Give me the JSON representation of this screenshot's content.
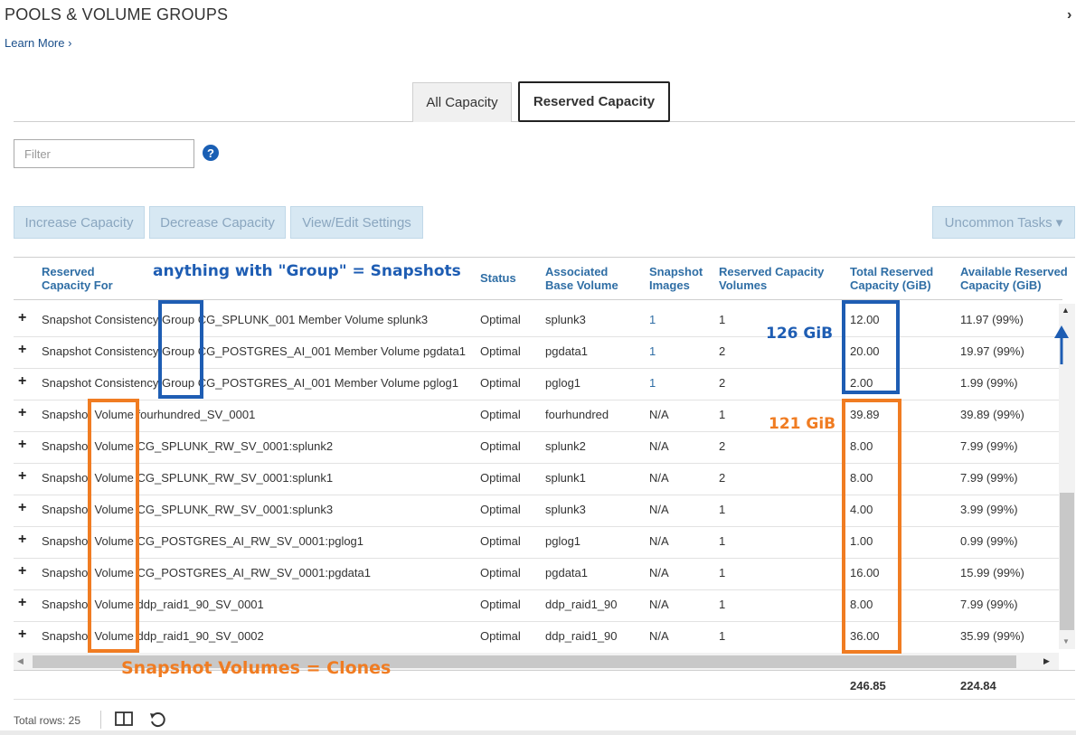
{
  "header": {
    "title": "POOLS & VOLUME GROUPS",
    "learn_more": "Learn More ›"
  },
  "tabs": [
    {
      "label": "All Capacity",
      "active": false
    },
    {
      "label": "Reserved Capacity",
      "active": true
    }
  ],
  "filter": {
    "placeholder": "Filter"
  },
  "toolbar": {
    "increase": "Increase Capacity",
    "decrease": "Decrease Capacity",
    "view_edit": "View/Edit Settings",
    "uncommon": "Uncommon Tasks ▾"
  },
  "columns": {
    "reserved_for": "Reserved Capacity For",
    "status": "Status",
    "base_volume": "Associated Base Volume",
    "snapshot_images": "Snapshot Images",
    "rc_volumes": "Reserved Capacity Volumes",
    "total_reserved": "Total Reserved Capacity (GiB)",
    "available_reserved": "Available Reserved Capacity (GiB)"
  },
  "rows": [
    {
      "name": "Snapshot Consistency Group CG_SPLUNK_001 Member Volume splunk3",
      "status": "Optimal",
      "base": "splunk3",
      "images": "1",
      "volumes": "1",
      "total": "12.00",
      "available": "11.97 (99%)"
    },
    {
      "name": "Snapshot Consistency Group CG_POSTGRES_AI_001 Member Volume pgdata1",
      "status": "Optimal",
      "base": "pgdata1",
      "images": "1",
      "volumes": "2",
      "total": "20.00",
      "available": "19.97 (99%)"
    },
    {
      "name": "Snapshot Consistency Group CG_POSTGRES_AI_001 Member Volume pglog1",
      "status": "Optimal",
      "base": "pglog1",
      "images": "1",
      "volumes": "2",
      "total": "2.00",
      "available": "1.99 (99%)"
    },
    {
      "name": "Snapshot Volume fourhundred_SV_0001",
      "status": "Optimal",
      "base": "fourhundred",
      "images": "N/A",
      "volumes": "1",
      "total": "39.89",
      "available": "39.89 (99%)"
    },
    {
      "name": "Snapshot Volume CG_SPLUNK_RW_SV_0001:splunk2",
      "status": "Optimal",
      "base": "splunk2",
      "images": "N/A",
      "volumes": "2",
      "total": "8.00",
      "available": "7.99 (99%)"
    },
    {
      "name": "Snapshot Volume CG_SPLUNK_RW_SV_0001:splunk1",
      "status": "Optimal",
      "base": "splunk1",
      "images": "N/A",
      "volumes": "2",
      "total": "8.00",
      "available": "7.99 (99%)"
    },
    {
      "name": "Snapshot Volume CG_SPLUNK_RW_SV_0001:splunk3",
      "status": "Optimal",
      "base": "splunk3",
      "images": "N/A",
      "volumes": "1",
      "total": "4.00",
      "available": "3.99 (99%)"
    },
    {
      "name": "Snapshot Volume CG_POSTGRES_AI_RW_SV_0001:pglog1",
      "status": "Optimal",
      "base": "pglog1",
      "images": "N/A",
      "volumes": "1",
      "total": "1.00",
      "available": "0.99 (99%)"
    },
    {
      "name": "Snapshot Volume CG_POSTGRES_AI_RW_SV_0001:pgdata1",
      "status": "Optimal",
      "base": "pgdata1",
      "images": "N/A",
      "volumes": "1",
      "total": "16.00",
      "available": "15.99 (99%)"
    },
    {
      "name": "Snapshot Volume ddp_raid1_90_SV_0001",
      "status": "Optimal",
      "base": "ddp_raid1_90",
      "images": "N/A",
      "volumes": "1",
      "total": "8.00",
      "available": "7.99 (99%)"
    },
    {
      "name": "Snapshot Volume ddp_raid1_90_SV_0002",
      "status": "Optimal",
      "base": "ddp_raid1_90",
      "images": "N/A",
      "volumes": "1",
      "total": "36.00",
      "available": "35.99 (99%)"
    }
  ],
  "totals": {
    "total_reserved": "246.85",
    "available_reserved": "224.84"
  },
  "footer": {
    "total_rows": "Total rows: 25"
  },
  "annotations": {
    "group_note": "anything with \"Group\" = Snapshots",
    "blue_capacity": "126 GiB",
    "orange_capacity": "121 GiB",
    "volume_note": "Snapshot Volumes = Clones",
    "blue_color": "#1e5db3",
    "orange_color": "#f07c22"
  }
}
